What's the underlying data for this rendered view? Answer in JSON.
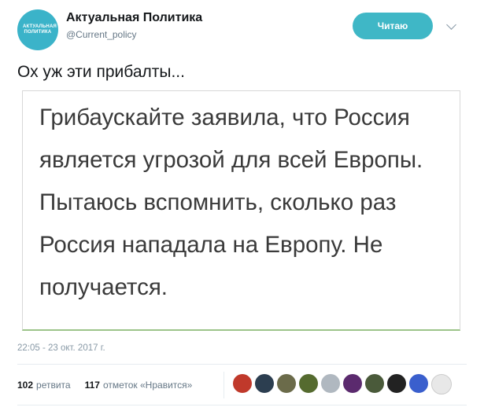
{
  "author": {
    "avatar_text": "АКТУАЛЬНАЯ ПОЛИТИКА",
    "display_name": "Актуальная Политика",
    "handle": "@Current_policy"
  },
  "follow_button": {
    "label": "Читаю"
  },
  "tweet": {
    "text": "Ох уж эти прибалты..."
  },
  "quote_card": {
    "text": "Грибаускайте заявила, что Россия является угрозой для всей Европы. Пытаюсь вспомнить, сколько раз Россия нападала на Европу. Не получается."
  },
  "timestamp": "22:05 - 23 окт. 2017 г.",
  "stats": {
    "retweets_count": "102",
    "retweets_label": "ретвита",
    "likes_count": "117",
    "likes_label": "отметок «Нравится»"
  },
  "likers": [
    {
      "icon": "user-avatar",
      "color": "#c0392b"
    },
    {
      "icon": "user-avatar",
      "color": "#2c3e50"
    },
    {
      "icon": "user-avatar",
      "color": "#6b6b4a"
    },
    {
      "icon": "user-avatar",
      "color": "#556b2f"
    },
    {
      "icon": "user-avatar",
      "color": "#b0b8c0"
    },
    {
      "icon": "user-avatar",
      "color": "#5b2a6e"
    },
    {
      "icon": "user-avatar",
      "color": "#4a5a3a"
    },
    {
      "icon": "user-avatar",
      "color": "#222222"
    },
    {
      "icon": "user-avatar",
      "color": "#3a5fcd"
    },
    {
      "icon": "user-avatar",
      "color": "#e8e8e8"
    }
  ]
}
